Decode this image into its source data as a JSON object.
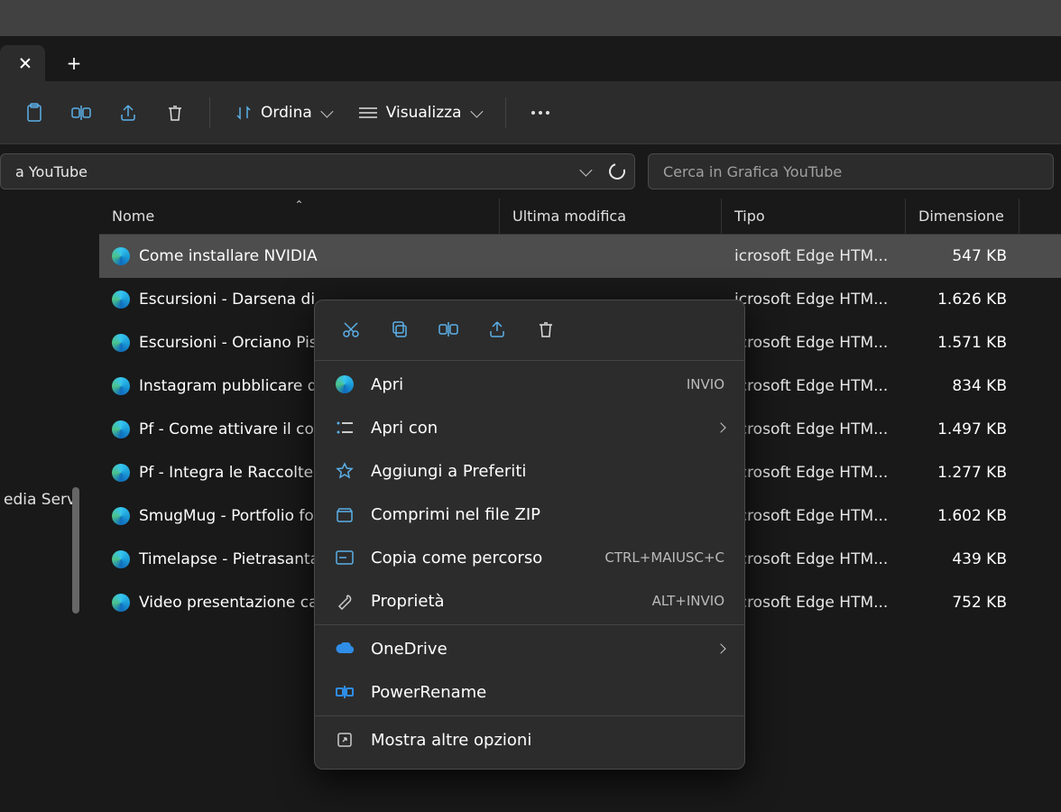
{
  "breadcrumb": {
    "label": "a YouTube"
  },
  "search": {
    "placeholder": "Cerca in Grafica YouTube"
  },
  "toolbar": {
    "sort_label": "Ordina",
    "view_label": "Visualizza"
  },
  "columns": {
    "name": "Nome",
    "modified": "Ultima modifica",
    "type": "Tipo",
    "size": "Dimensione"
  },
  "sidebar": {
    "item": "edia Serv"
  },
  "files": [
    {
      "name": "Come installare NVIDIA",
      "type": "icrosoft Edge HTM...",
      "size": "547 KB",
      "selected": true
    },
    {
      "name": "Escursioni - Darsena di",
      "type": "icrosoft Edge HTM...",
      "size": "1.626 KB"
    },
    {
      "name": "Escursioni - Orciano Pis",
      "type": "icrosoft Edge HTM...",
      "size": "1.571 KB"
    },
    {
      "name": "Instagram pubblicare d",
      "type": "icrosoft Edge HTM...",
      "size": "834 KB"
    },
    {
      "name": "Pf - Come attivare il coo",
      "type": "icrosoft Edge HTM...",
      "size": "1.497 KB"
    },
    {
      "name": "Pf - Integra le Raccolte",
      "type": "icrosoft Edge HTM...",
      "size": "1.277 KB"
    },
    {
      "name": "SmugMug - Portfolio fo",
      "type": "icrosoft Edge HTM...",
      "size": "1.602 KB"
    },
    {
      "name": "Timelapse - Pietrasanta",
      "type": "icrosoft Edge HTM...",
      "size": "439 KB"
    },
    {
      "name": "Video presentazione ca",
      "type": "icrosoft Edge HTM...",
      "size": "752 KB"
    }
  ],
  "context_menu": {
    "open": {
      "label": "Apri",
      "shortcut": "INVIO"
    },
    "open_with": {
      "label": "Apri con"
    },
    "favorites": {
      "label": "Aggiungi a Preferiti"
    },
    "zip": {
      "label": "Comprimi nel file ZIP"
    },
    "copy_path": {
      "label": "Copia come percorso",
      "shortcut": "CTRL+MAIUSC+C"
    },
    "properties": {
      "label": "Proprietà",
      "shortcut": "ALT+INVIO"
    },
    "onedrive": {
      "label": "OneDrive"
    },
    "powerrename": {
      "label": "PowerRename"
    },
    "more": {
      "label": "Mostra altre opzioni"
    }
  }
}
